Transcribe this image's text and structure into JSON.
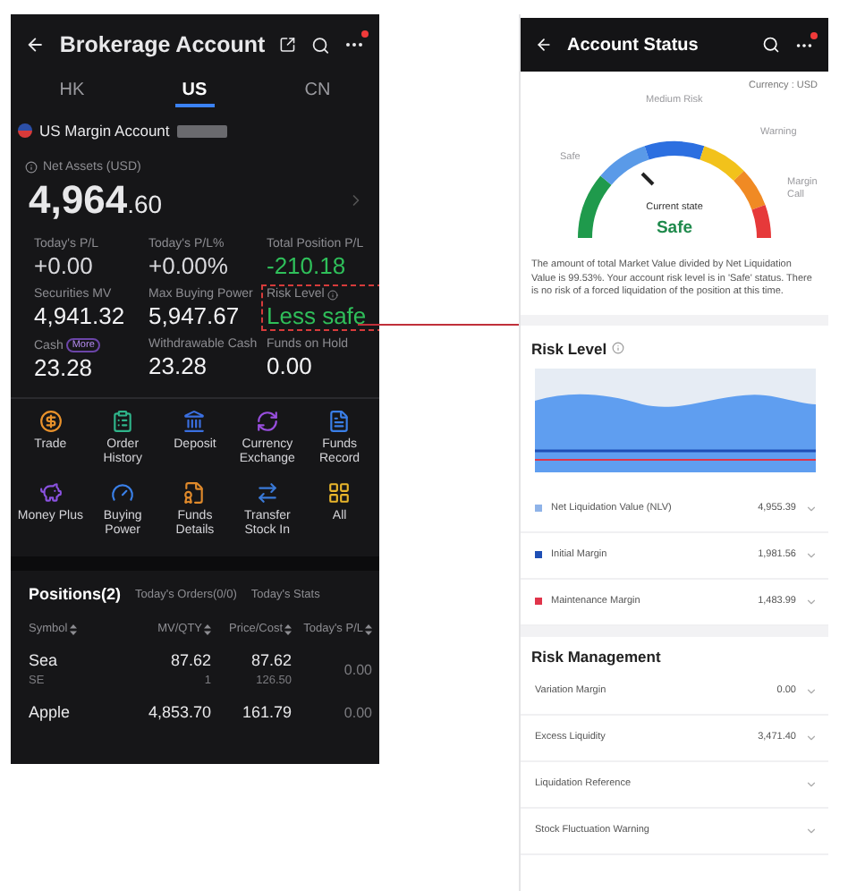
{
  "brokerage": {
    "title": "Brokerage Account",
    "tabs": [
      {
        "label": "HK",
        "selected": false
      },
      {
        "label": "US",
        "selected": true
      },
      {
        "label": "CN",
        "selected": false
      }
    ],
    "account": "US Margin Account",
    "net_assets_label": "Net Assets (USD)",
    "net_assets_whole": "4,964",
    "net_assets_decimal": ".60",
    "stats": [
      {
        "label": "Today's P/L",
        "value": "+0.00",
        "color": "#d8d8dc",
        "highlighted": false
      },
      {
        "label": "Today's P/L%",
        "value": "+0.00%",
        "color": "#d8d8dc",
        "highlighted": false
      },
      {
        "label": "Total Position P/L",
        "value": "-210.18",
        "color": "#2fbf5a",
        "highlighted": false
      },
      {
        "label": "Securities MV",
        "value": "4,941.32",
        "color": "#f2f2f4",
        "highlighted": false
      },
      {
        "label": "Max Buying Power",
        "value": "5,947.67",
        "color": "#f2f2f4",
        "highlighted": false
      },
      {
        "label": "Risk Level",
        "value": "Less safe",
        "color": "#2fbf5a",
        "highlighted": true
      },
      {
        "label": "Cash",
        "badge": "More",
        "value": "23.28",
        "color": "#f2f2f4",
        "highlighted": false
      },
      {
        "label": "Withdrawable Cash",
        "value": "23.28",
        "color": "#f2f2f4",
        "highlighted": false
      },
      {
        "label": "Funds on Hold",
        "value": "0.00",
        "color": "#f2f2f4",
        "highlighted": false
      }
    ],
    "actions": [
      {
        "label": "Trade",
        "kind": "trade",
        "color": "#e8912b"
      },
      {
        "label": "Order History",
        "kind": "history",
        "color": "#2fb58a"
      },
      {
        "label": "Deposit",
        "kind": "deposit",
        "color": "#3a6fe0"
      },
      {
        "label": "Currency Exchange",
        "kind": "exchange",
        "color": "#9a4fe0"
      },
      {
        "label": "Funds Record",
        "kind": "record",
        "color": "#3a7fe8"
      },
      {
        "label": "Money Plus",
        "kind": "piggy",
        "color": "#8a52e0"
      },
      {
        "label": "Buying Power",
        "kind": "power",
        "color": "#3a80e8"
      },
      {
        "label": "Funds Details",
        "kind": "details",
        "color": "#e08a2b"
      },
      {
        "label": "Transfer Stock In",
        "kind": "transfer",
        "color": "#3a7ad8"
      },
      {
        "label": "All",
        "kind": "all",
        "color": "#e8b52b"
      }
    ],
    "position_tabs": [
      {
        "label": "Positions(2)",
        "selected": true
      },
      {
        "label": "Today's Orders(0/0)",
        "selected": false
      },
      {
        "label": "Today's Stats",
        "selected": false
      }
    ],
    "columns": [
      "Symbol",
      "MV/QTY",
      "Price/Cost",
      "Today's P/L"
    ],
    "rows": [
      {
        "name": "Sea",
        "code": "SE",
        "mv": "87.62",
        "qty": "1",
        "price": "87.62",
        "cost": "126.50",
        "pl": "0.00"
      },
      {
        "name": "Apple",
        "mv": "4,853.70",
        "price": "161.79",
        "pl": "0.00"
      }
    ]
  },
  "status": {
    "title": "Account Status",
    "currency": "Currency : USD",
    "gauge_labels": [
      "Safe",
      "Medium Risk",
      "Warning",
      "Margin Call"
    ],
    "state_label": "Current state",
    "state": "Safe",
    "description": "The amount of total Market Value divided by Net Liquidation Value is 99.53%.  Your account risk level is in 'Safe' status. There is no risk of a forced liquidation of the position at this time.",
    "risk_level_title": "Risk Level",
    "legend": [
      {
        "label": "Net Liquidation Value (NLV)",
        "value": "4,955.39",
        "color": "#8fb3e8"
      },
      {
        "label": "Initial Margin",
        "value": "1,981.56",
        "color": "#1f4fb5"
      },
      {
        "label": "Maintenance Margin",
        "value": "1,483.99",
        "color": "#e0344a"
      }
    ],
    "risk_management_title": "Risk Management",
    "risk_rows": [
      {
        "label": "Variation Margin",
        "value": "0.00"
      },
      {
        "label": "Excess Liquidity",
        "value": "3,471.40"
      },
      {
        "label": "Liquidation Reference"
      },
      {
        "label": "Stock Fluctuation Warning"
      }
    ]
  }
}
